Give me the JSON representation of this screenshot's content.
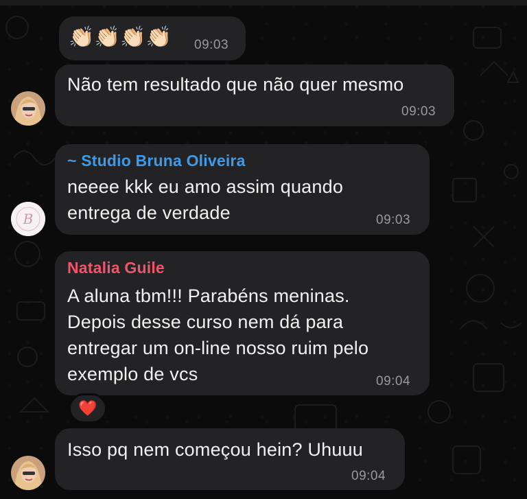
{
  "messages": [
    {
      "time": "09:03",
      "emoji": "👏🏻👏🏻👏🏻👏🏻"
    },
    {
      "text": "Não tem resultado que não quer mesmo",
      "time": "09:03"
    },
    {
      "sender": "~ Studio Bruna Oliveira",
      "text": "neeee kkk eu amo assim quando\nentrega de verdade",
      "time": "09:03"
    },
    {
      "sender": "Natalia Guile",
      "text": "A aluna tbm!!! Parabéns meninas.\nDepois desse curso nem dá para\nentregar um on-line nosso ruim pelo\nexemplo de vcs",
      "time": "09:04",
      "reaction": "❤️"
    },
    {
      "text": "Isso pq nem começou hein? Uhuuu",
      "time": "09:04"
    }
  ],
  "colors": {
    "bubble": "#232325",
    "background": "#0b0b0b",
    "sender_studio": "#3d9be9",
    "sender_natalia": "#f0566b",
    "timestamp": "#9a9a9e"
  },
  "icons": {
    "avatar_user": "avatar-photo",
    "avatar_studio": "studio-logo-avatar",
    "reaction": "heart-icon"
  }
}
